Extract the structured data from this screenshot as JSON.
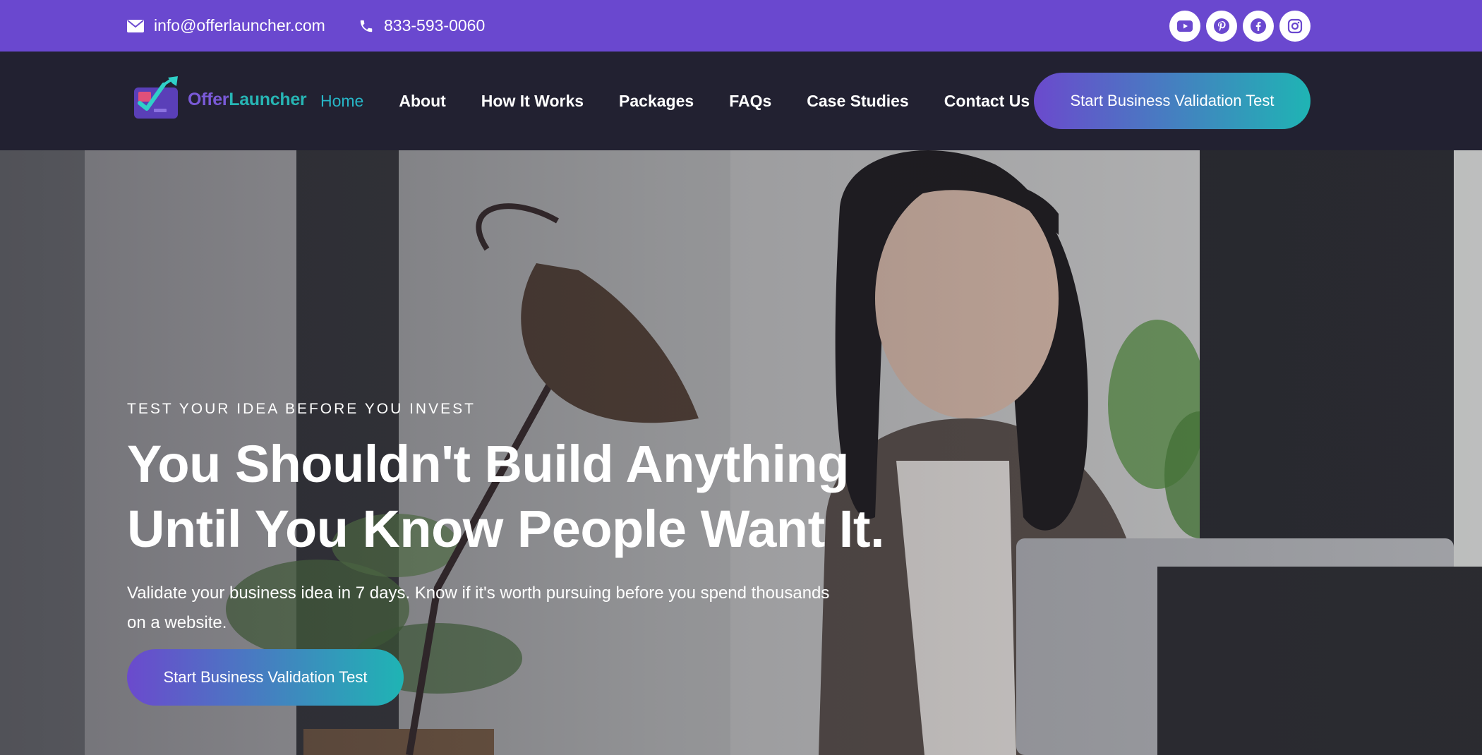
{
  "topbar": {
    "email": "info@offerlauncher.com",
    "phone": "833-593-0060",
    "email_icon": "envelope-icon",
    "phone_icon": "phone-icon",
    "socials": [
      "youtube-icon",
      "pinterest-icon",
      "facebook-icon",
      "instagram-icon"
    ],
    "bg_color": "#6a48cf"
  },
  "brand": {
    "part1": "Offer",
    "part2": "Launcher"
  },
  "nav": {
    "items": [
      {
        "label": "Home",
        "active": true
      },
      {
        "label": "About"
      },
      {
        "label": "How It Works"
      },
      {
        "label": "Packages"
      },
      {
        "label": "FAQs"
      },
      {
        "label": "Case Studies"
      },
      {
        "label": "Contact Us"
      }
    ],
    "cta": "Start Business Validation Test",
    "bg_color": "#222131",
    "active_color": "#27b6c7"
  },
  "hero": {
    "eyebrow": "TEST YOUR IDEA BEFORE YOU INVEST",
    "headline_line1": "You Shouldn't Build Anything",
    "headline_line2": "Until You Know People Want It.",
    "subtext": "Validate your business idea in 7 days. Know if it's worth pursuing before you spend thousands on a website.",
    "cta": "Start Business Validation Test",
    "gradient": [
      "#6b4acd",
      "#1fb4b4"
    ]
  }
}
